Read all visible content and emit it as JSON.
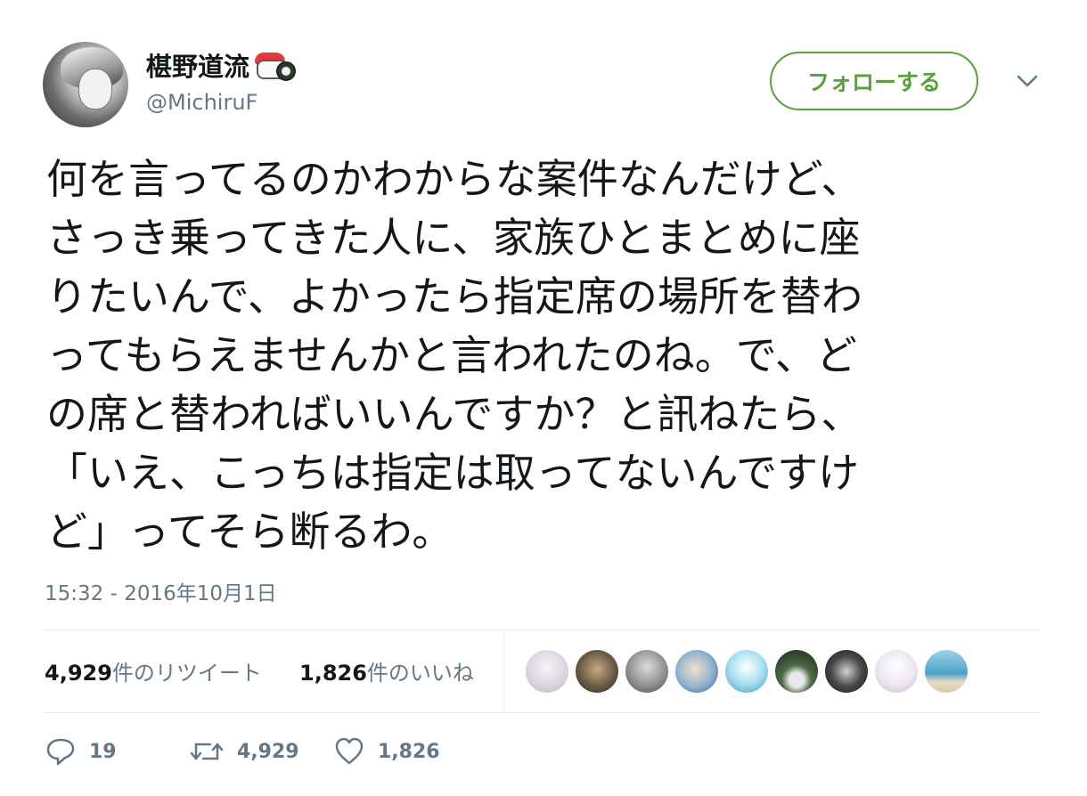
{
  "user": {
    "display_name": "椹野道流",
    "name_emoji_icon": "sushi-icon",
    "handle": "@MichiruF"
  },
  "follow_button": {
    "label": "フォローする",
    "color": "#5aa13b"
  },
  "more_menu": {
    "icon": "chevron-down-icon"
  },
  "tweet": {
    "lines": [
      "何を言ってるのかわからな案件なんだけど、",
      "さっき乗ってきた人に、家族ひとまとめに座",
      "りたいんで、よかったら指定席の場所を替わ",
      "ってもらえませんかと言われたのね。で、ど",
      "の席と替わればいいんですか？と訊ねたら、",
      "「いえ、こっちは指定は取ってないんですけ",
      "ど」ってそら断るわ。"
    ],
    "timestamp": "15:32 - 2016年10月1日"
  },
  "stats": {
    "retweets_count": "4,929",
    "retweets_label": "件のリツイート",
    "likes_count": "1,826",
    "likes_label": "件のいいね"
  },
  "likers": [
    {
      "name": "liker-avatar-1",
      "color": "#e7e3ea"
    },
    {
      "name": "liker-avatar-2",
      "color": "#5a5040"
    },
    {
      "name": "liker-avatar-3",
      "color": "#8a8a8a"
    },
    {
      "name": "liker-avatar-4",
      "color": "#6f8fb0"
    },
    {
      "name": "liker-avatar-5",
      "color": "#7fc6e0"
    },
    {
      "name": "liker-avatar-6",
      "color": "#2b3a2a"
    },
    {
      "name": "liker-avatar-7",
      "color": "#1c1c1c"
    },
    {
      "name": "liker-avatar-8",
      "color": "#e9e4ef"
    },
    {
      "name": "liker-avatar-9",
      "color": "#4aa3c8"
    }
  ],
  "actions": {
    "reply_count": "19",
    "retweet_count": "4,929",
    "like_count": "1,826",
    "icons": [
      "reply-icon",
      "retweet-icon",
      "heart-icon"
    ]
  }
}
